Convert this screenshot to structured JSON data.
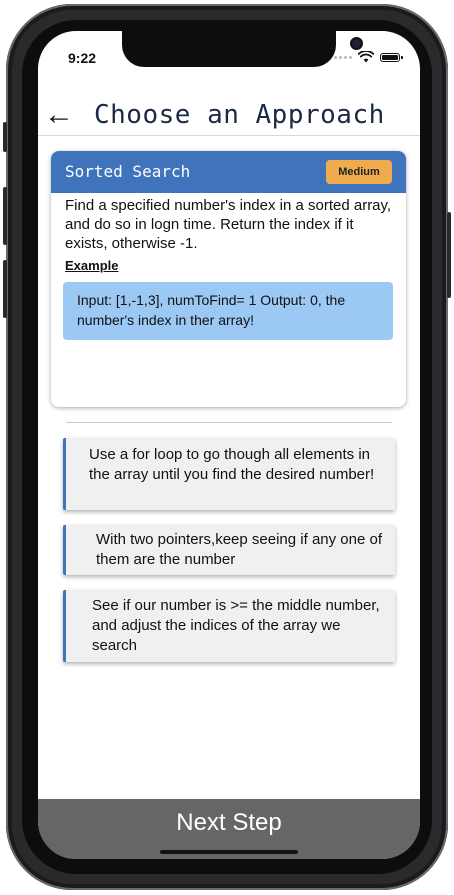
{
  "status_bar": {
    "time": "9:22"
  },
  "header": {
    "back_icon": "arrow-left-icon",
    "title": "Choose an Approach"
  },
  "problem": {
    "title": "Sorted Search",
    "difficulty": "Medium",
    "description": "Find a specified number's index in a sorted array, and do so in logn time. Return the index if it exists, otherwise -1.",
    "example_label": "Example",
    "example_text": "Input: [1,-1,3], numToFind= 1 Output: 0, the number's index in ther array!"
  },
  "options": [
    {
      "text": "Use a for loop to go though all elements in the array until you find the desired number!"
    },
    {
      "text": "With two pointers,keep seeing if any one of them are the number"
    },
    {
      "text": "See if our number is >= the middle number, and adjust the indices of the array we search"
    }
  ],
  "footer": {
    "next_label": "Next Step"
  },
  "colors": {
    "card_header": "#3f74bd",
    "badge": "#efac4e",
    "example_bg": "#9cc8f4",
    "footer_bg": "#666666",
    "title_text": "#1b2a44"
  }
}
